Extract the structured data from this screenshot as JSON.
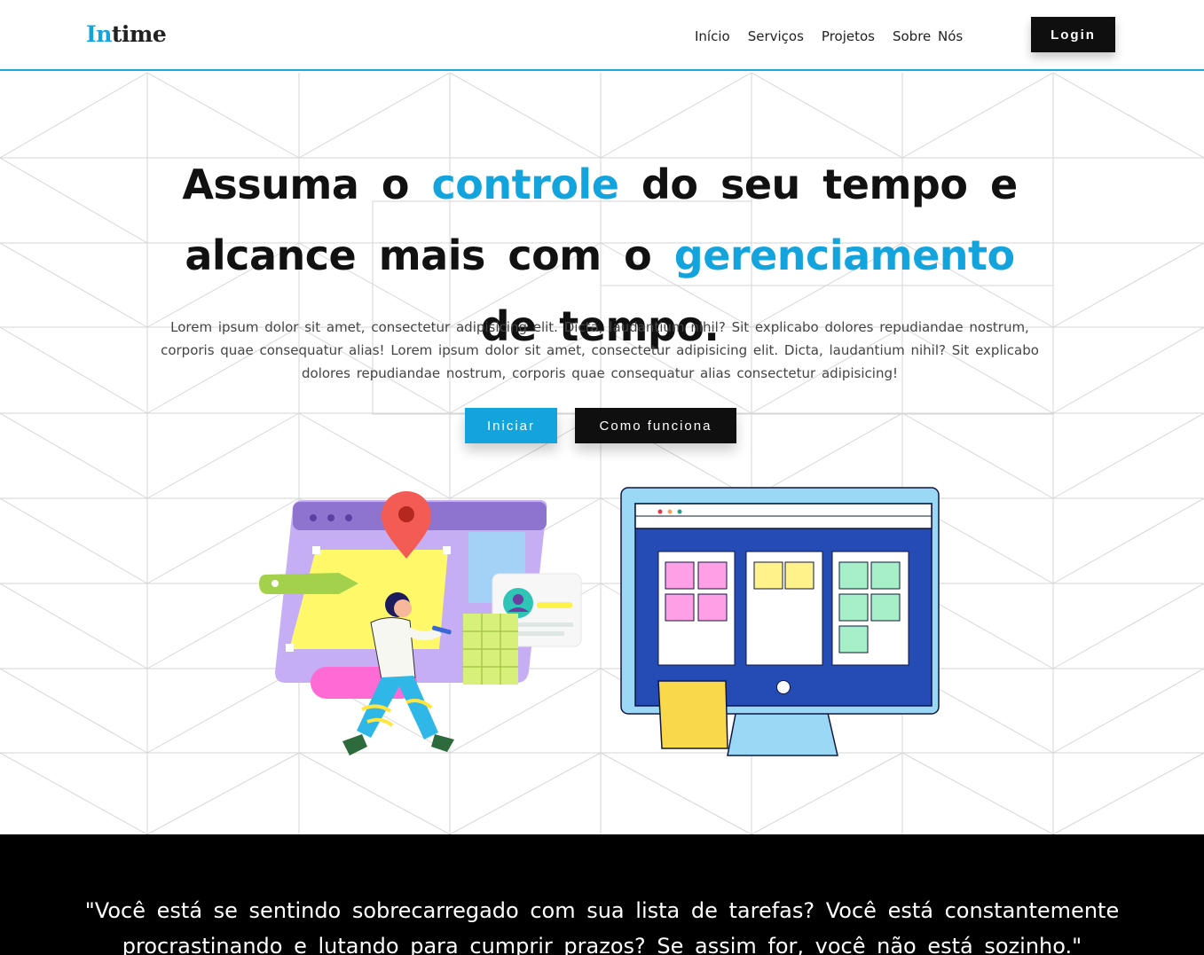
{
  "header": {
    "logo_accent": "In",
    "logo_rest": "time",
    "nav": [
      "Início",
      "Serviços",
      "Projetos",
      "Sobre Nós"
    ],
    "login_label": "Login"
  },
  "hero": {
    "title_part1": "Assuma o ",
    "title_highlight1": "controle",
    "title_part2": " do seu tempo e alcance mais com o ",
    "title_highlight2": "gerenciamento",
    "title_part3": " de tempo.",
    "description": "Lorem ipsum dolor sit amet, consectetur adipisicing elit. Dicta, laudantium nihil? Sit explicabo dolores repudiandae nostrum, corporis quae consequatur alias! Lorem ipsum dolor sit amet, consectetur adipisicing elit. Dicta, laudantium nihil? Sit explicabo dolores repudiandae nostrum, corporis quae consequatur alias consectetur adipisicing!",
    "start_label": "Iniciar",
    "how_label": "Como funciona"
  },
  "quote": {
    "text": "\"Você está se sentindo sobrecarregado com sua lista de tarefas? Você está constantemente procrastinando e lutando para cumprir prazos? Se assim for, você não está sozinho.\""
  },
  "colors": {
    "accent": "#13a4dd",
    "dark": "#0f0f0f"
  },
  "icons": [
    "location-pin-icon",
    "user-avatar-icon",
    "window-dots-icon"
  ]
}
